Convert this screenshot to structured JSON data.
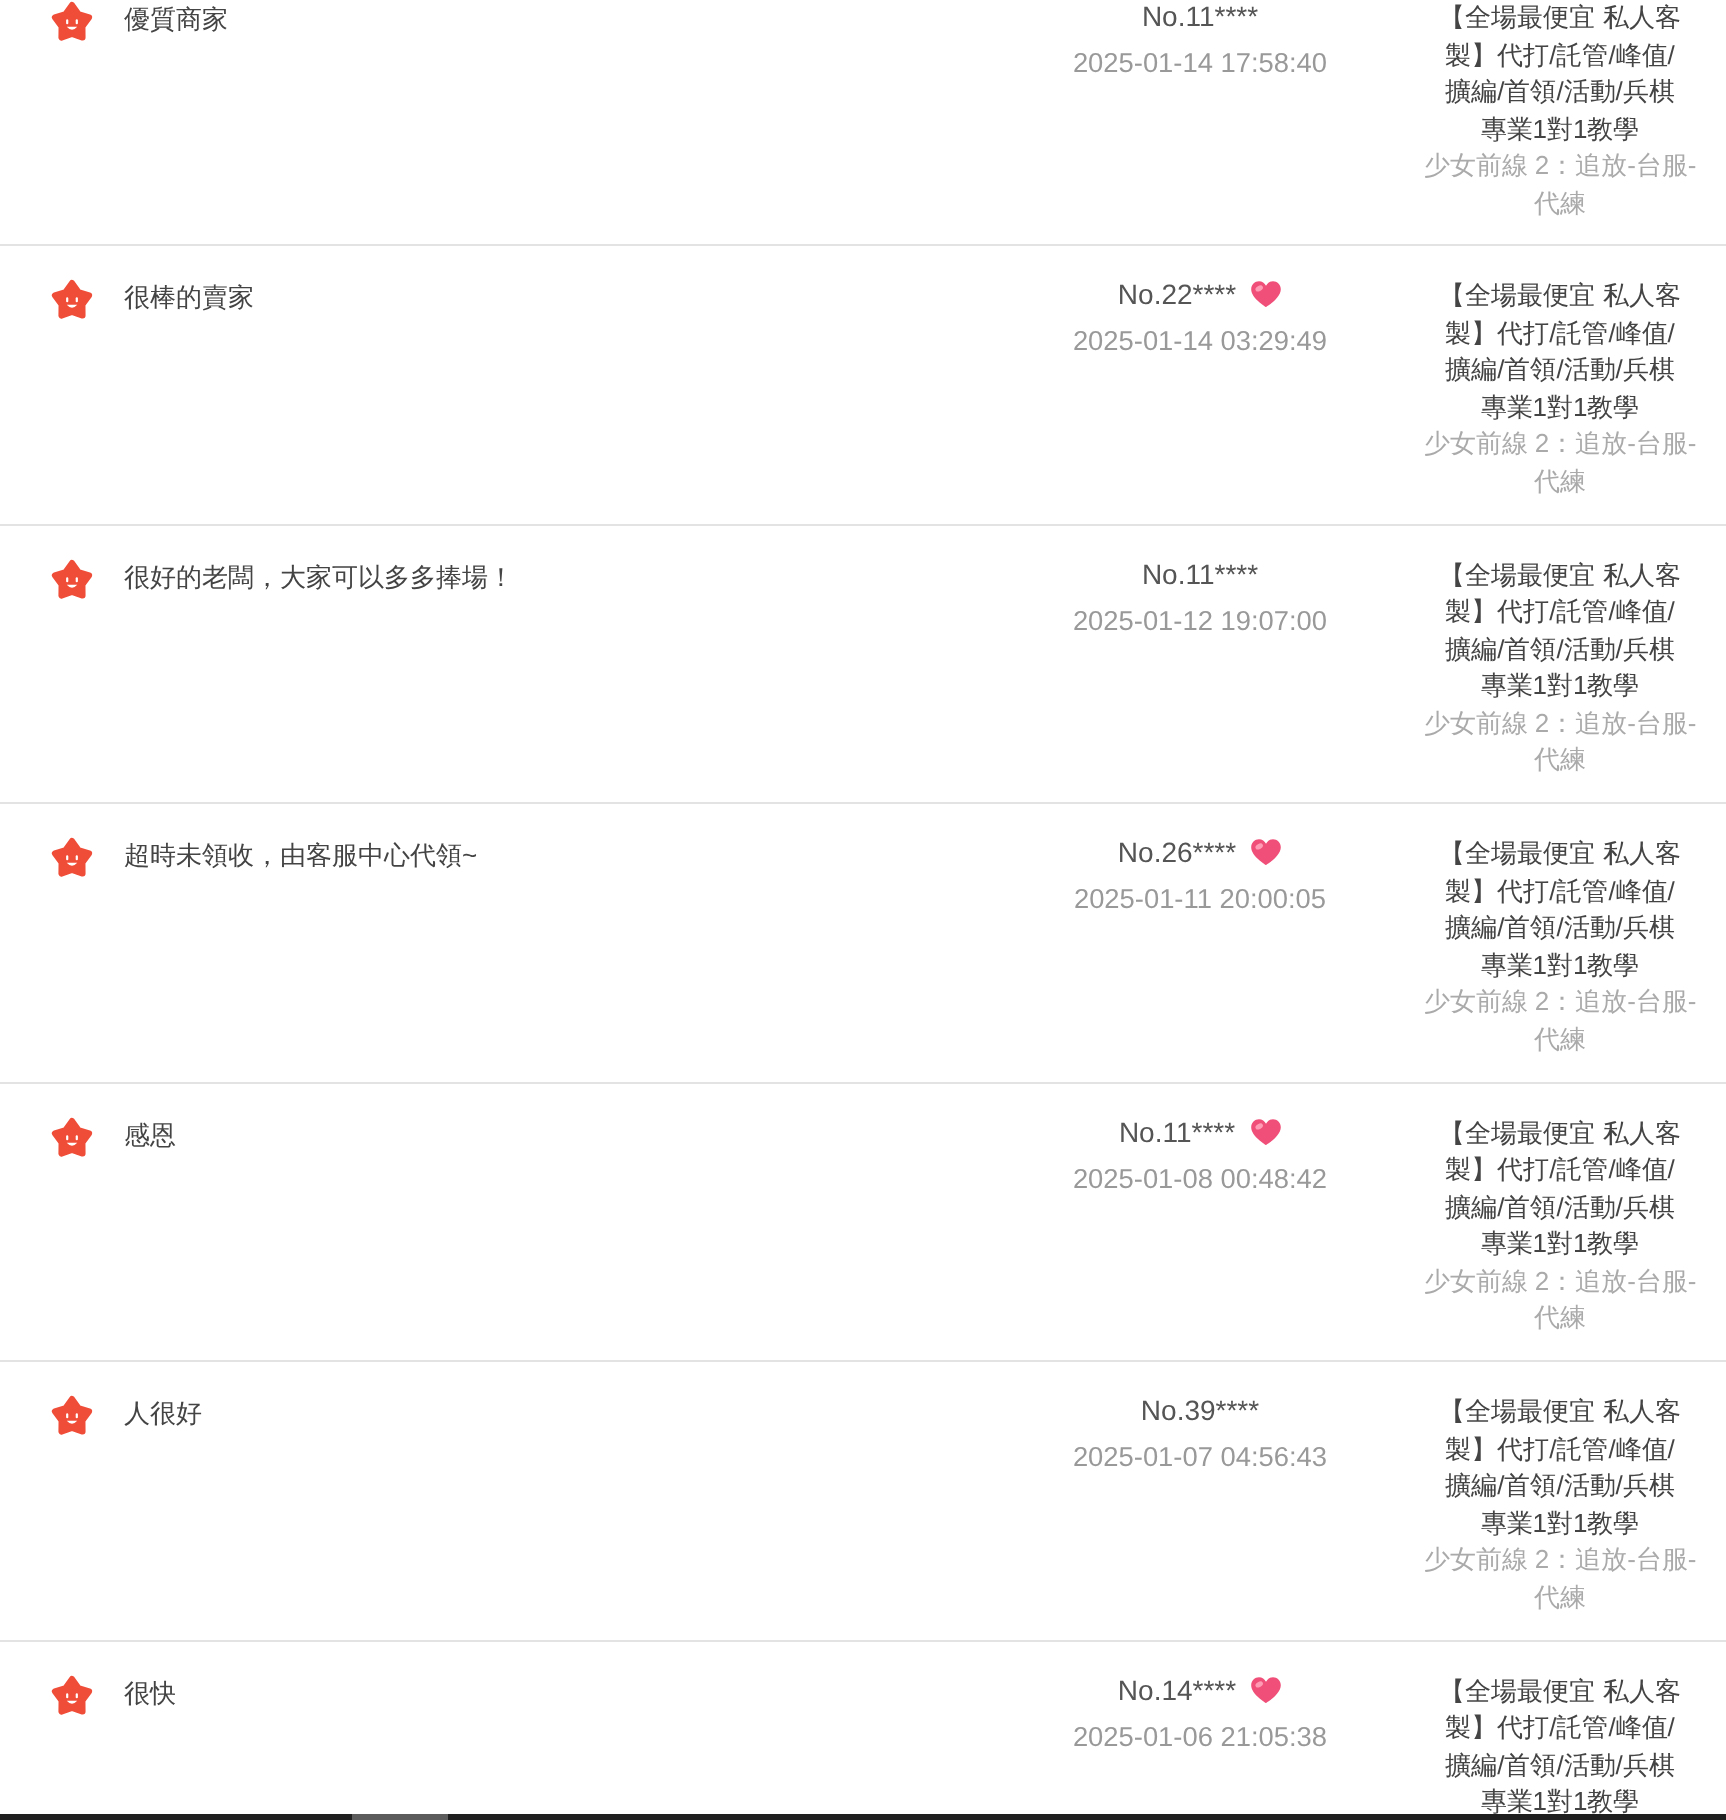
{
  "reviews": [
    {
      "comment": "優質商家",
      "buyer": "No.11****",
      "heart": false,
      "time": "2025-01-14 17:58:40",
      "product": "【全場最便宜 私人客製】代打/託管/峰值/擴編/首領/活動/兵棋專業1對1教學",
      "category": "少女前線 2：追放-台服-代練"
    },
    {
      "comment": "很棒的賣家",
      "buyer": "No.22****",
      "heart": true,
      "time": "2025-01-14 03:29:49",
      "product": "【全場最便宜 私人客製】代打/託管/峰值/擴編/首領/活動/兵棋專業1對1教學",
      "category": "少女前線 2：追放-台服-代練"
    },
    {
      "comment": "很好的老闆，大家可以多多捧場！",
      "buyer": "No.11****",
      "heart": false,
      "time": "2025-01-12 19:07:00",
      "product": "【全場最便宜 私人客製】代打/託管/峰值/擴編/首領/活動/兵棋專業1對1教學",
      "category": "少女前線 2：追放-台服-代練"
    },
    {
      "comment": "超時未領收，由客服中心代領~",
      "buyer": "No.26****",
      "heart": true,
      "time": "2025-01-11 20:00:05",
      "product": "【全場最便宜 私人客製】代打/託管/峰值/擴編/首領/活動/兵棋專業1對1教學",
      "category": "少女前線 2：追放-台服-代練"
    },
    {
      "comment": "感恩",
      "buyer": "No.11****",
      "heart": true,
      "time": "2025-01-08 00:48:42",
      "product": "【全場最便宜 私人客製】代打/託管/峰值/擴編/首領/活動/兵棋專業1對1教學",
      "category": "少女前線 2：追放-台服-代練"
    },
    {
      "comment": "人很好",
      "buyer": "No.39****",
      "heart": false,
      "time": "2025-01-07 04:56:43",
      "product": "【全場最便宜 私人客製】代打/託管/峰值/擴編/首領/活動/兵棋專業1對1教學",
      "category": "少女前線 2：追放-台服-代練"
    },
    {
      "comment": "很快",
      "buyer": "No.14****",
      "heart": true,
      "time": "2025-01-06 21:05:38",
      "product": "【全場最便宜 私人客製】代打/託管/峰值/擴編/首領/活動/兵棋專業1對1教學"
    }
  ]
}
